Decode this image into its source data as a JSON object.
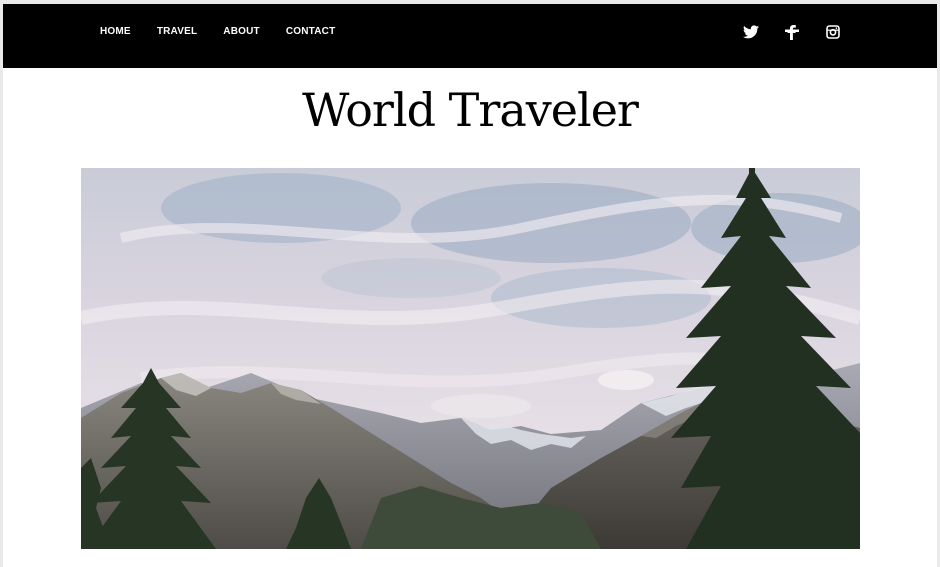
{
  "nav": {
    "links": [
      "HOME",
      "TRAVEL",
      "ABOUT",
      "CONTACT"
    ]
  },
  "social": {
    "icons": [
      "twitter-icon",
      "facebook-icon",
      "instagram-icon"
    ]
  },
  "site": {
    "title": "World Traveler"
  },
  "colors": {
    "navbar": "#000000",
    "nav_text": "#ffffff",
    "page_background": "#ffffff",
    "title_text": "#000000"
  }
}
